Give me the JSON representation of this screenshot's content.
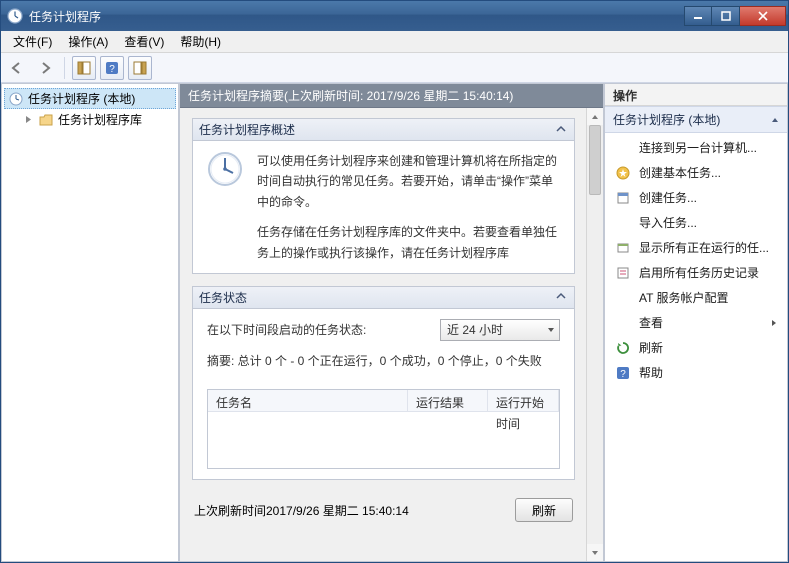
{
  "window": {
    "title": "任务计划程序"
  },
  "menu": {
    "file": "文件(F)",
    "action": "操作(A)",
    "view": "查看(V)",
    "help": "帮助(H)"
  },
  "tree": {
    "root": "任务计划程序 (本地)",
    "library": "任务计划程序库"
  },
  "center": {
    "header": "任务计划程序摘要(上次刷新时间: 2017/9/26 星期二 15:40:14)",
    "overview": {
      "title": "任务计划程序概述",
      "para1": "可以使用任务计划程序来创建和管理计算机将在所指定的时间自动执行的常见任务。若要开始，请单击“操作”菜单中的命令。",
      "para2": "任务存储在任务计划程序库的文件夹中。若要查看单独任务上的操作或执行该操作，请在任务计划程序库"
    },
    "status": {
      "title": "任务状态",
      "rangeLabel": "在以下时间段启动的任务状态:",
      "rangeValue": "近 24 小时",
      "summary": "摘要: 总计 0 个 - 0 个正在运行，0 个成功，0 个停止，0 个失败",
      "columns": {
        "name": "任务名",
        "result": "运行结果",
        "start": "运行开始时间"
      }
    },
    "footer": {
      "lastRefresh": "上次刷新时间2017/9/26 星期二 15:40:14",
      "refreshBtn": "刷新"
    }
  },
  "actions": {
    "paneTitle": "操作",
    "sectionTitle": "任务计划程序 (本地)",
    "items": {
      "connect": "连接到另一台计算机...",
      "createBasic": "创建基本任务...",
      "createTask": "创建任务...",
      "import": "导入任务...",
      "showRunning": "显示所有正在运行的任...",
      "enableHistory": "启用所有任务历史记录",
      "atService": "AT 服务帐户配置",
      "view": "查看",
      "refresh": "刷新",
      "help": "帮助"
    }
  }
}
